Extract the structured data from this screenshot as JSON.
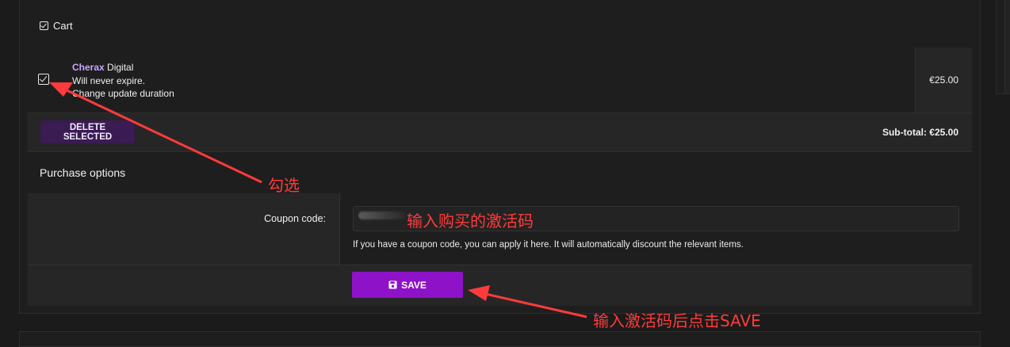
{
  "cart": {
    "title": "Cart",
    "item": {
      "brand": "Cherax",
      "name": " Digital",
      "expiry": "Will never expire.",
      "update_link": "Change update duration",
      "price": "€25.00"
    },
    "delete_label": "DELETE SELECTED",
    "subtotal": "Sub-total: €25.00"
  },
  "purchase": {
    "title": "Purchase options",
    "coupon_label": "Coupon code:",
    "coupon_help": "If you have a coupon code, you can apply it here. It will automatically discount the relevant items.",
    "save_label": "SAVE"
  },
  "annotations": {
    "check": "勾选",
    "enter_code": "输入购买的激活码",
    "click_save": "输入激活码后点击SAVE",
    "color": "#ff3b3b"
  },
  "colors": {
    "accent": "#8e12c8",
    "brand": "#c9a6ff",
    "delete_bg": "#3a1b52"
  }
}
